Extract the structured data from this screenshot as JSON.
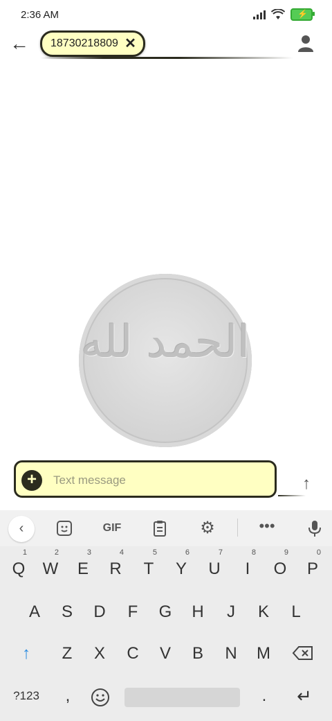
{
  "status": {
    "time": "2:36 AM"
  },
  "header": {
    "recipient": "18730218809"
  },
  "compose": {
    "placeholder": "Text message"
  },
  "keyboard": {
    "toolbar": {
      "gif": "GIF"
    },
    "row1": [
      {
        "k": "Q",
        "n": "1"
      },
      {
        "k": "W",
        "n": "2"
      },
      {
        "k": "E",
        "n": "3"
      },
      {
        "k": "R",
        "n": "4"
      },
      {
        "k": "T",
        "n": "5"
      },
      {
        "k": "Y",
        "n": "6"
      },
      {
        "k": "U",
        "n": "7"
      },
      {
        "k": "I",
        "n": "8"
      },
      {
        "k": "O",
        "n": "9"
      },
      {
        "k": "P",
        "n": "0"
      }
    ],
    "row2": [
      "A",
      "S",
      "D",
      "F",
      "G",
      "H",
      "J",
      "K",
      "L"
    ],
    "row3": [
      "Z",
      "X",
      "C",
      "V",
      "B",
      "N",
      "M"
    ],
    "symbols": "?123",
    "comma": ",",
    "period": "."
  },
  "icons": {
    "back": "back-arrow-icon",
    "remove": "close-icon",
    "contact": "person-icon",
    "add": "add-icon",
    "send": "send-arrow-icon"
  },
  "colors": {
    "accent": "#ffffc2",
    "accent_border": "#2b2b1e"
  }
}
